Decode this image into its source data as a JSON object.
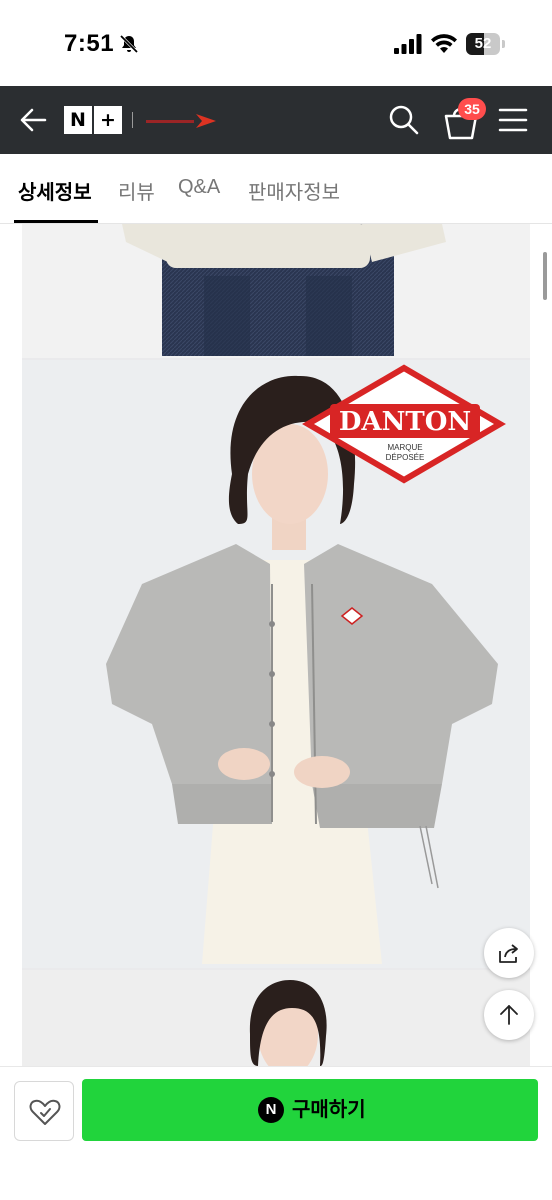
{
  "status_bar": {
    "time": "7:51",
    "battery": "52",
    "battery_level": 0.52,
    "icons": [
      "bell-slash-icon",
      "cellular-signal-icon",
      "wifi-icon",
      "battery-icon"
    ]
  },
  "header": {
    "logo_left": "N",
    "logo_right": "+",
    "cart_count": "35",
    "icons": [
      "arrow-left-icon",
      "search-icon",
      "cart-icon",
      "hamburger-menu-icon"
    ]
  },
  "tabs": [
    {
      "label": "상세정보",
      "active": true
    },
    {
      "label": "리뷰",
      "active": false
    },
    {
      "label": "Q&A",
      "active": false
    },
    {
      "label": "판매자정보",
      "active": false
    }
  ],
  "product_images": {
    "brand_logo_text": "DANTON",
    "brand_logo_sub1": "MARQUE",
    "brand_logo_sub2": "DÉPOSÉE",
    "brand_color": "#d82525"
  },
  "floating": {
    "icons": [
      "share-icon",
      "arrow-up-icon"
    ]
  },
  "bottom_bar": {
    "buy_label": "구매하기",
    "npay_mark": "N",
    "buy_color": "#21d43c",
    "icons": [
      "wish-heart-icon"
    ]
  }
}
